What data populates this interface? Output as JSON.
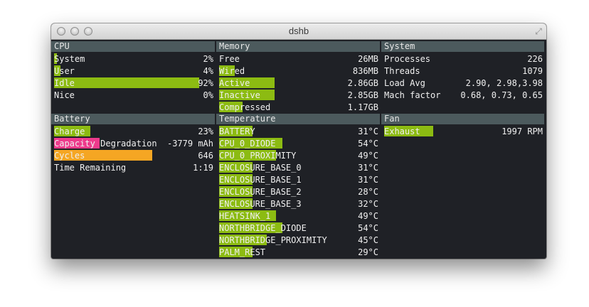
{
  "window": {
    "title": "dshb"
  },
  "cpu": {
    "header": "CPU",
    "rows": [
      {
        "label": "System",
        "value": "2%",
        "fill": 0.02
      },
      {
        "label": "User",
        "value": "4%",
        "fill": 0.04
      },
      {
        "label": "Idle",
        "value": "92%",
        "fill": 0.92
      },
      {
        "label": "Nice",
        "value": "0%",
        "fill": 0.0
      }
    ]
  },
  "memory": {
    "header": "Memory",
    "rows": [
      {
        "label": "Free",
        "value": "26MB",
        "fill": 0.0
      },
      {
        "label": "Wired",
        "value": "836MB",
        "fill": 0.1
      },
      {
        "label": "Active",
        "value": "2.86GB",
        "fill": 0.35
      },
      {
        "label": "Inactive",
        "value": "2.85GB",
        "fill": 0.35
      },
      {
        "label": "Compressed",
        "value": "1.17GB",
        "fill": 0.15
      }
    ]
  },
  "system": {
    "header": "System",
    "rows": [
      {
        "label": "Processes",
        "value": "226"
      },
      {
        "label": "Threads",
        "value": "1079"
      },
      {
        "label": "Load Avg",
        "value": "2.90, 2.98,3.98"
      },
      {
        "label": "Mach factor",
        "value": "0.68, 0.73, 0.65"
      }
    ]
  },
  "battery": {
    "header": "Battery",
    "rows": [
      {
        "label": "Charge",
        "value": "23%",
        "fill": 0.23,
        "color": "#8cbb12"
      },
      {
        "label": "Capacity",
        "label2": "Degradation",
        "value": "-3779 mAh",
        "fill": 0.29,
        "color": "#ee3a8c"
      },
      {
        "label": "Cycles",
        "value": "646",
        "fill": 0.62,
        "color": "#f5a623"
      },
      {
        "label": "Time Remaining",
        "value": "1:19",
        "fill": 0.0,
        "color": "#8cbb12"
      }
    ]
  },
  "temperature": {
    "header": "Temperature",
    "rows": [
      {
        "label": "BATTERY",
        "value": "31°C",
        "fill": 0.21
      },
      {
        "label": "CPU_0_DIODE",
        "value": "54°C",
        "fill": 0.4
      },
      {
        "label": "CPU_0_PROXIMITY",
        "value": "49°C",
        "fill": 0.36
      },
      {
        "label": "ENCLOSURE_BASE_0",
        "value": "31°C",
        "fill": 0.21
      },
      {
        "label": "ENCLOSURE_BASE_1",
        "value": "31°C",
        "fill": 0.21
      },
      {
        "label": "ENCLOSURE_BASE_2",
        "value": "28°C",
        "fill": 0.21
      },
      {
        "label": "ENCLOSURE_BASE_3",
        "value": "32°C",
        "fill": 0.21
      },
      {
        "label": "HEATSINK_1",
        "value": "49°C",
        "fill": 0.36
      },
      {
        "label": "NORTHBRIDGE_DIODE",
        "value": "54°C",
        "fill": 0.4
      },
      {
        "label": "NORTHBRIDGE_PROXIMITY",
        "value": "45°C",
        "fill": 0.3
      },
      {
        "label": "PALM_REST",
        "value": "29°C",
        "fill": 0.21
      }
    ]
  },
  "fan": {
    "header": "Fan",
    "rows": [
      {
        "label": "Exhaust",
        "value": "1997 RPM",
        "fill": 0.31
      }
    ]
  },
  "colors": {
    "bar_green": "#8cbb12",
    "bar_pink": "#ee3a8c",
    "bar_orange": "#f5a623",
    "header_bg": "#4c5a5d",
    "window_bg": "#1f2126"
  }
}
